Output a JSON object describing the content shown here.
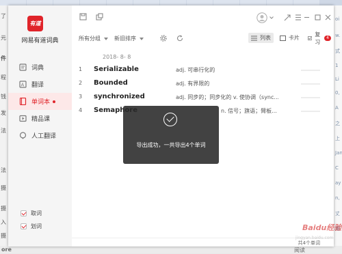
{
  "app": {
    "name": "网易有道词典",
    "logo_text": "有道"
  },
  "sidebar": {
    "items": [
      {
        "label": "词典",
        "icon": "dictionary-icon"
      },
      {
        "label": "翻译",
        "icon": "translate-icon"
      },
      {
        "label": "单词本",
        "icon": "wordbook-icon",
        "active": true
      },
      {
        "label": "精品课",
        "icon": "course-icon"
      },
      {
        "label": "人工翻译",
        "icon": "human-translate-icon"
      }
    ],
    "checks": [
      {
        "label": "取词",
        "checked": true
      },
      {
        "label": "划词",
        "checked": true
      }
    ]
  },
  "toolbar": {
    "filter_group": "所有分组",
    "sort": "新旧排序",
    "view_list": "列表",
    "view_card": "卡片",
    "review": "复习",
    "review_badge": "4"
  },
  "word_list": {
    "date": "2018- 8- 8",
    "rows": [
      {
        "num": "1",
        "word": "Serializable",
        "def": "adj. 可串行化的"
      },
      {
        "num": "2",
        "word": "Bounded",
        "def": "adj. 有界限的"
      },
      {
        "num": "3",
        "word": "synchronized",
        "def": "adj. 同步的；同步化的  v. 使协调（sync..."
      },
      {
        "num": "4",
        "word": "Semaphore",
        "def": "n. 信号；旗语；臂板..."
      }
    ]
  },
  "toast": {
    "message": "导出成功，一共导出4个单词"
  },
  "footer": {
    "count": "共4个单词"
  },
  "background": {
    "left_chars": [
      "了",
      "元",
      "件",
      "程",
      "钱",
      "发",
      "法",
      "法",
      "摄",
      "摄",
      "入",
      "摄",
      "方"
    ],
    "right_chars": [
      "oi",
      "w.",
      "式",
      "1",
      "Li",
      "0,",
      "A",
      "之",
      "上",
      "Jan",
      "C",
      "ay",
      "n,",
      "丈",
      "用"
    ],
    "bottom_left": "ore",
    "bottom_right": "阅读"
  },
  "watermark": {
    "text": "Baidu经验",
    "sub": "jingyan.baidu.com"
  },
  "colors": {
    "accent": "#e0242a",
    "sidebar_bg": "#f5f5f5",
    "toast_bg": "#282828"
  }
}
